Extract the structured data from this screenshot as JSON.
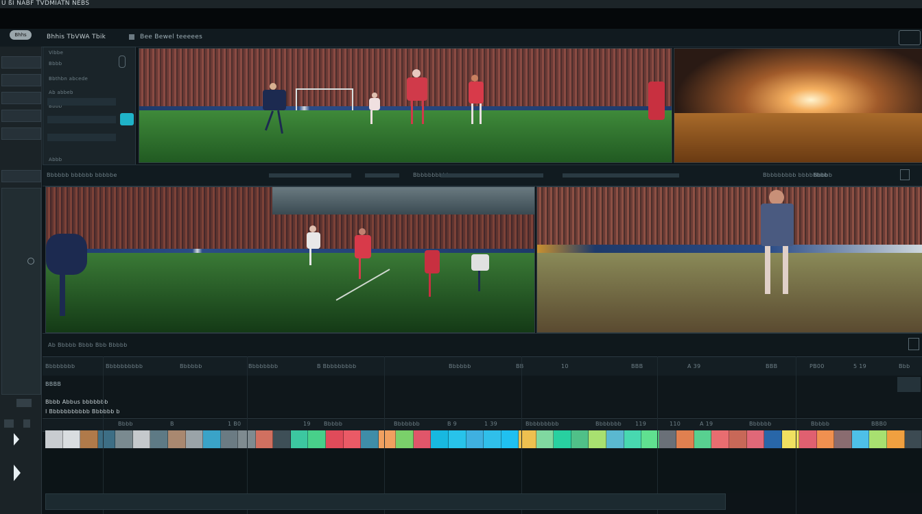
{
  "app": {
    "title": "Ü ßI NABF TVDMIATN NEBS"
  },
  "toolbar": {
    "logo": "Bhhs",
    "project_label": "Bhhis TbVWA Tbik",
    "menu_label": "Bee Bewel teeeees"
  },
  "panel": {
    "rows": [
      "Vibbe",
      "Bbbb",
      "Bbthbn abcede",
      "Ab abbeb",
      "Bbbb",
      "Abbb"
    ]
  },
  "viewer_bar": {
    "left_label": "Bbbbbb bbbbbb bbbbbe",
    "mid_label": "Bbbbbbbbbb",
    "right_label": "Bbbbbbbbb bbbbbbbb",
    "far_label": "Bbbbb"
  },
  "player_strip": {
    "label": "Ab  Bbbbb  Bbbb  Bbb  Bbbbb"
  },
  "timeline_header": {
    "columns": [
      "Bbbbbbbb",
      "Bbbbbbbbbb",
      "Bbbbbb",
      "Bbbbbbbb",
      "B  Bbbbbbbbb",
      "Bbbbbb",
      "BB",
      "10",
      "BBB",
      "A 39",
      "BBB",
      "PB00",
      "5 19",
      "Bbb"
    ]
  },
  "timeline_sub": {
    "label_1": "BBBB",
    "label_2": "Bbbb Abbus bbbbbbb",
    "label_3": "I Bbbbbbbbbbb Bbbbbb b"
  },
  "ruler": {
    "ticks": [
      "Bbbb",
      "B",
      "1 B0",
      "19",
      "Bbbbb",
      "Bbbbbbb",
      "B  9",
      "1 39",
      "Bbbbbbbbb",
      "Bbbbbbb",
      "119",
      "110",
      "A 19",
      "Bbbbbb",
      "Bbbbb",
      "BBB0"
    ]
  },
  "colors": {
    "accent": "#1fb3c8",
    "background": "#0d1418",
    "pitch": "#2f6b2f"
  },
  "clips": [
    "#c8ccd0",
    "#d9dde0",
    "#b07a4a",
    "#3d6e85",
    "#7a8a90",
    "#c5c9cc",
    "#5e7a85",
    "#a98870",
    "#9aa3a8",
    "#3aa3c8",
    "#6b7b83",
    "#7f8b90",
    "#d07060",
    "#3e4f57",
    "#3cc7a0",
    "#48d08a",
    "#e04b5a",
    "#ea5a66",
    "#3f8da8",
    "#f0a060",
    "#7ad06a",
    "#e0566a",
    "#18b8e0",
    "#28c3ea",
    "#3fb0e0",
    "#30bfea",
    "#20c0f0",
    "#eec050",
    "#80d8a0",
    "#28d0a0",
    "#50c088",
    "#a8e070",
    "#5ab8d0",
    "#48d8b0",
    "#60e090",
    "#6a7078",
    "#e08050",
    "#58d090",
    "#e86d70",
    "#c86858",
    "#e06878",
    "#2866a8",
    "#f0e060",
    "#e06070",
    "#f09050",
    "#8a6c70",
    "#4ec0e8",
    "#a8e070",
    "#f0a040",
    "#3c4a52"
  ],
  "icons": [
    "logo-icon",
    "play-icon",
    "menu-icon"
  ]
}
